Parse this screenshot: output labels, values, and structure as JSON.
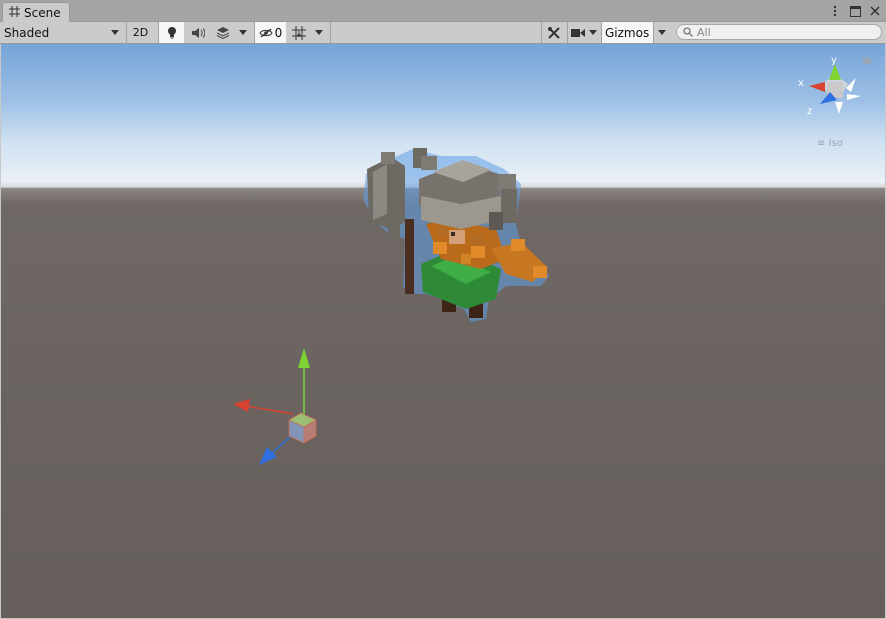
{
  "tab": {
    "title": "Scene",
    "icon": "grid-icon"
  },
  "window_controls": [
    "more-options-icon",
    "maximize-icon",
    "close-icon"
  ],
  "toolbar": {
    "draw_mode": "Shaded",
    "mode_2d": "2D",
    "hidden_count": "0",
    "gizmos_label": "Gizmos"
  },
  "search": {
    "placeholder": "All",
    "value": ""
  },
  "orientation_gizmo": {
    "y": "y",
    "x": "x",
    "z": "z",
    "projection": "Iso"
  },
  "colors": {
    "x_axis": "#d8422e",
    "y_axis": "#7ed232",
    "z_axis": "#2f6fe0",
    "selection_outline": "#5f9ee6"
  }
}
